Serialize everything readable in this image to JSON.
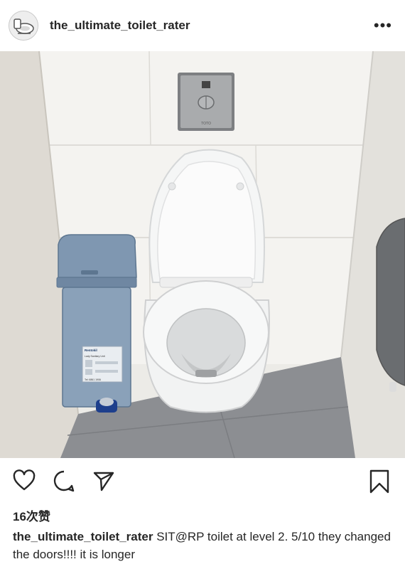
{
  "post": {
    "username": "the_ultimate_toilet_rater",
    "more_label": "•••",
    "likes": "16次赞",
    "caption_user": "the_ultimate_toilet_rater",
    "caption_text": "SIT@RP toilet at level 2. 5/10 they changed the doors!!!! it is longer"
  },
  "photo": {
    "bin_brand": "Rentokil",
    "bin_label": "Lady Sanitary Unit",
    "bin_phone": "Tel: 6861 1906",
    "flush_brand": "TOTO"
  },
  "icons": {
    "like": "heart-icon",
    "comment": "comment-icon",
    "share": "send-icon",
    "save": "bookmark-icon",
    "more": "more-icon"
  }
}
